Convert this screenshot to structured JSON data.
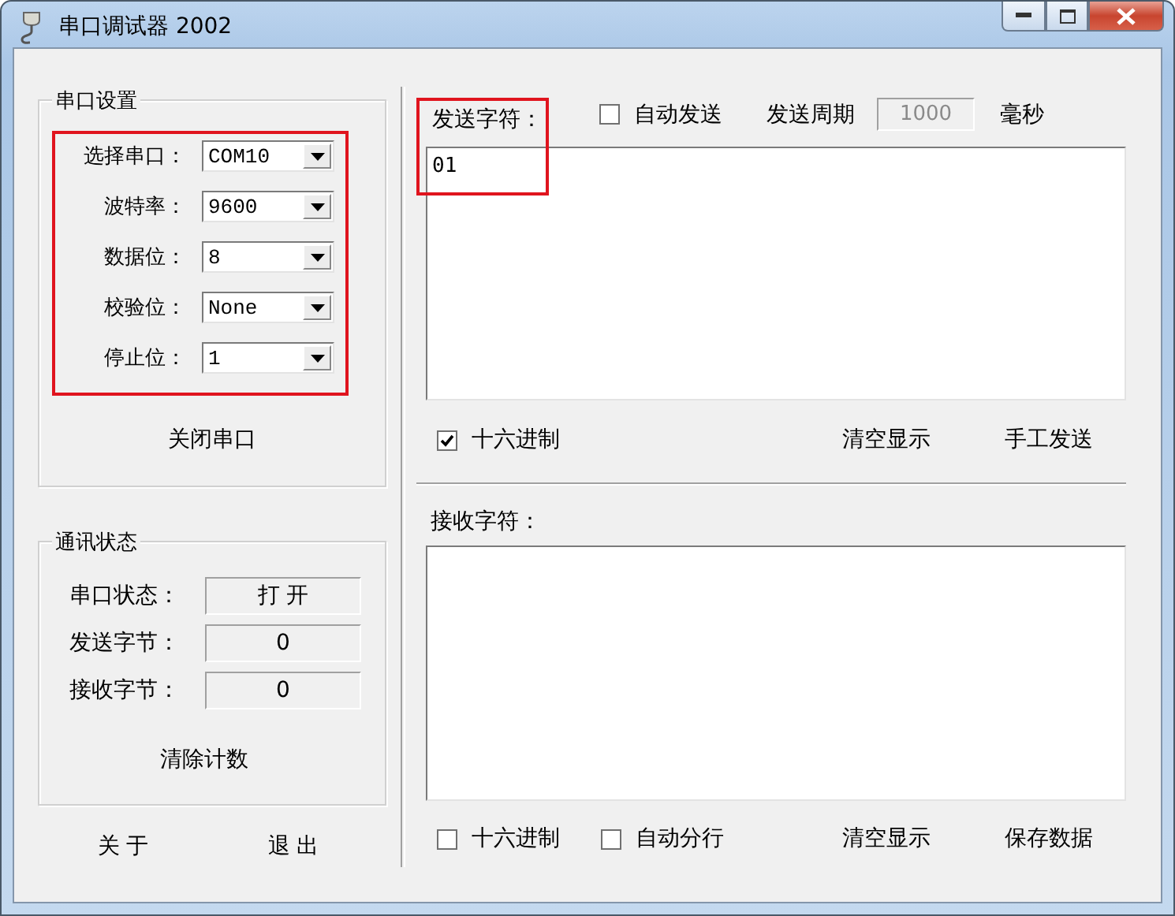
{
  "window": {
    "title": "串口调试器 2002"
  },
  "port_settings": {
    "title": "串口设置",
    "annotated": true,
    "fields": [
      {
        "label": "选择串口：",
        "value": "COM10"
      },
      {
        "label": "波特率：",
        "value": "9600"
      },
      {
        "label": "数据位：",
        "value": "8"
      },
      {
        "label": "校验位：",
        "value": "None"
      },
      {
        "label": "停止位：",
        "value": "1"
      }
    ],
    "toggle_button": "关闭串口"
  },
  "status": {
    "title": "通讯状态",
    "rows": [
      {
        "label": "串口状态：",
        "value": "打 开"
      },
      {
        "label": "发送字节：",
        "value": "0"
      },
      {
        "label": "接收字节：",
        "value": "0"
      }
    ],
    "clear_button": "清除计数"
  },
  "footer_buttons": [
    "关 于",
    "退 出"
  ],
  "send": {
    "label": "发送字符：",
    "annotated": true,
    "auto_send": {
      "label": "自动发送",
      "checked": false
    },
    "period_label": "发送周期",
    "period": {
      "value": "1000",
      "disabled": true
    },
    "unit": "毫秒",
    "text": "01",
    "hex": {
      "label": "十六进制",
      "checked": true
    },
    "buttons": [
      "清空显示",
      "手工发送"
    ]
  },
  "receive": {
    "label": "接收字符：",
    "hex": {
      "label": "十六进制",
      "checked": false
    },
    "auto_newline": {
      "label": "自动分行",
      "checked": false
    },
    "buttons": [
      "清空显示",
      "保存数据"
    ]
  }
}
